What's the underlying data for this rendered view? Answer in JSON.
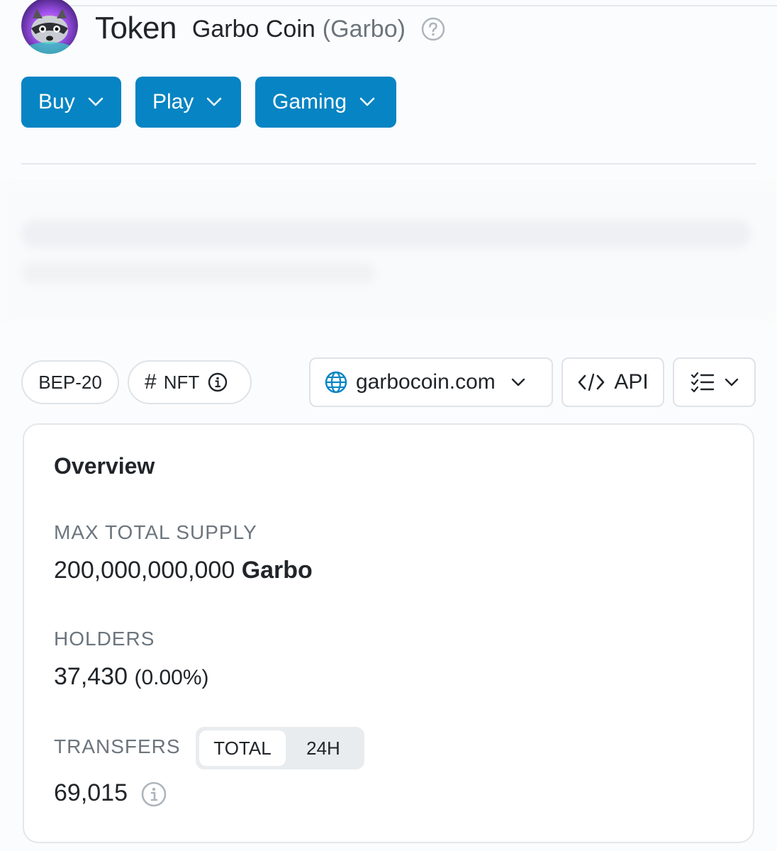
{
  "header": {
    "page_title": "Token",
    "token_name": "Garbo Coin",
    "token_symbol": "(Garbo)"
  },
  "actions": [
    {
      "label": "Buy"
    },
    {
      "label": "Play"
    },
    {
      "label": "Gaming"
    }
  ],
  "tags": {
    "standard": "BEP-20",
    "nft": "NFT"
  },
  "toolbar": {
    "website": "garbocoin.com",
    "api": "API"
  },
  "overview": {
    "title": "Overview",
    "max_supply_label": "MAX TOTAL SUPPLY",
    "max_supply_value": "200,000,000,000",
    "max_supply_unit": "Garbo",
    "holders_label": "HOLDERS",
    "holders_value": "37,430",
    "holders_change": "(0.00%)",
    "transfers_label": "TRANSFERS",
    "transfers_tabs": [
      "TOTAL",
      "24H"
    ],
    "transfers_value": "69,015"
  },
  "colors": {
    "accent": "#0784c3",
    "text": "#212529",
    "muted": "#6c757d",
    "border": "#dfe3e7"
  },
  "icons": {
    "avatar": "raccoon-avatar",
    "help": "question-circle-icon",
    "chevron": "chevron-down-icon",
    "info": "info-circle-icon",
    "globe": "globe-icon",
    "code": "code-icon",
    "list": "checklist-icon"
  }
}
